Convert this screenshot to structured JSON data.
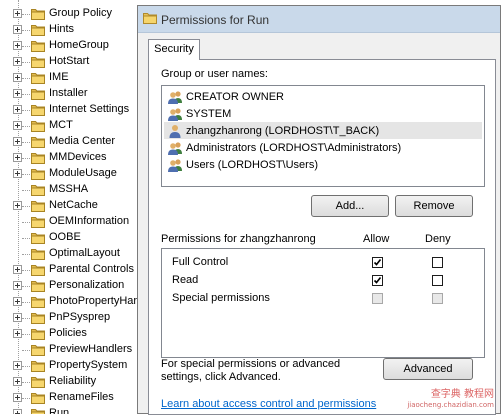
{
  "tree": {
    "items": [
      {
        "label": "Group Policy",
        "expandable": true
      },
      {
        "label": "Hints",
        "expandable": true
      },
      {
        "label": "HomeGroup",
        "expandable": true
      },
      {
        "label": "HotStart",
        "expandable": true
      },
      {
        "label": "IME",
        "expandable": true
      },
      {
        "label": "Installer",
        "expandable": true
      },
      {
        "label": "Internet Settings",
        "expandable": true
      },
      {
        "label": "MCT",
        "expandable": true
      },
      {
        "label": "Media Center",
        "expandable": true
      },
      {
        "label": "MMDevices",
        "expandable": true
      },
      {
        "label": "ModuleUsage",
        "expandable": true
      },
      {
        "label": "MSSHA",
        "expandable": false
      },
      {
        "label": "NetCache",
        "expandable": true
      },
      {
        "label": "OEMInformation",
        "expandable": false
      },
      {
        "label": "OOBE",
        "expandable": false
      },
      {
        "label": "OptimalLayout",
        "expandable": false
      },
      {
        "label": "Parental Controls",
        "expandable": true
      },
      {
        "label": "Personalization",
        "expandable": true
      },
      {
        "label": "PhotoPropertyHar",
        "expandable": true
      },
      {
        "label": "PnPSysprep",
        "expandable": true
      },
      {
        "label": "Policies",
        "expandable": true
      },
      {
        "label": "PreviewHandlers",
        "expandable": false
      },
      {
        "label": "PropertySystem",
        "expandable": true
      },
      {
        "label": "Reliability",
        "expandable": true
      },
      {
        "label": "RenameFiles",
        "expandable": true
      },
      {
        "label": "Run",
        "expandable": true
      }
    ]
  },
  "dialog": {
    "title": "Permissions for Run",
    "tab_label": "Security",
    "group_label": "Group or user names:",
    "users": [
      {
        "name": "CREATOR OWNER",
        "icon": "user-group-icon",
        "selected": false
      },
      {
        "name": "SYSTEM",
        "icon": "user-group-icon",
        "selected": false
      },
      {
        "name": "zhangzhanrong (LORDHOST\\T_BACK)",
        "icon": "user-icon",
        "selected": true
      },
      {
        "name": "Administrators (LORDHOST\\Administrators)",
        "icon": "user-group-icon",
        "selected": false
      },
      {
        "name": "Users (LORDHOST\\Users)",
        "icon": "user-group-icon",
        "selected": false
      }
    ],
    "add_label": "Add...",
    "remove_label": "Remove",
    "permissions_for_label": "Permissions for zhangzhanrong",
    "allow_header": "Allow",
    "deny_header": "Deny",
    "permissions": [
      {
        "name": "Full Control",
        "allow": true,
        "deny": false,
        "disabled": false
      },
      {
        "name": "Read",
        "allow": true,
        "deny": false,
        "disabled": false
      },
      {
        "name": "Special permissions",
        "allow": false,
        "deny": false,
        "disabled": true
      }
    ],
    "special_text": "For special permissions or advanced settings, click Advanced.",
    "advanced_label": "Advanced",
    "learn_link": "Learn about access control and permissions"
  },
  "watermark": {
    "text": "查字典 教程网",
    "small": "jiaocheng.chazidian.com"
  },
  "colors": {
    "titlebar": "#c9d9ea",
    "link": "#0066cc",
    "selection": "#e5e5e5"
  }
}
